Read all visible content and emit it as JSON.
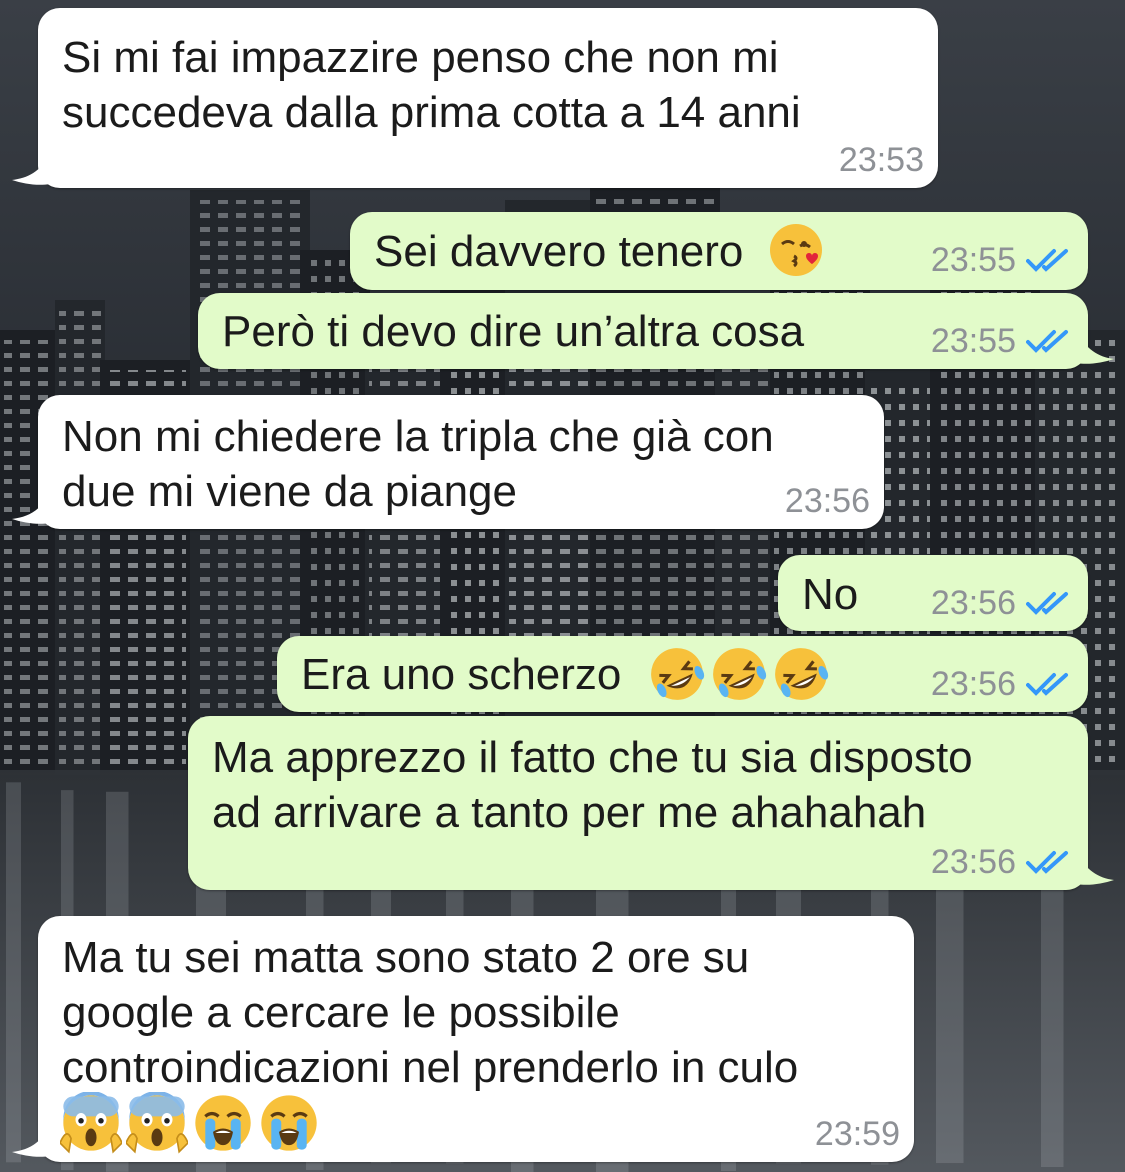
{
  "chat": {
    "messages": [
      {
        "direction": "incoming",
        "lines": [
          "Si mi fai impazzire penso che non mi",
          "succedeva dalla prima cotta a 14 anni"
        ],
        "time": "23:53"
      },
      {
        "direction": "outgoing",
        "text": "Sei davvero tenero",
        "emojis": [
          "face-blowing-a-kiss"
        ],
        "time": "23:55",
        "status": "read"
      },
      {
        "direction": "outgoing",
        "text": "Però ti devo dire un’altra cosa",
        "time": "23:55",
        "status": "read"
      },
      {
        "direction": "incoming",
        "lines": [
          "Non mi chiedere la tripla che già con",
          "due mi viene da piange"
        ],
        "time": "23:56"
      },
      {
        "direction": "outgoing",
        "text": "No",
        "time": "23:56",
        "status": "read"
      },
      {
        "direction": "outgoing",
        "text": "Era uno scherzo",
        "emojis": [
          "rolling-on-floor-laughing",
          "rolling-on-floor-laughing",
          "rolling-on-floor-laughing"
        ],
        "time": "23:56",
        "status": "read"
      },
      {
        "direction": "outgoing",
        "lines": [
          "Ma apprezzo il fatto che tu sia disposto",
          "ad arrivare a tanto per me ahahahah"
        ],
        "time": "23:56",
        "status": "read"
      },
      {
        "direction": "incoming",
        "lines": [
          "Ma tu sei matta sono stato 2 ore su",
          "google a cercare le possibile",
          "controindicazioni nel prenderlo in culo"
        ],
        "emojis": [
          "face-screaming-in-fear",
          "face-screaming-in-fear",
          "loudly-crying-face",
          "loudly-crying-face"
        ],
        "time": "23:59"
      }
    ]
  },
  "colors": {
    "incoming_bubble": "#ffffff",
    "outgoing_bubble": "#e2fbc9",
    "timestamp": "#8e9196",
    "read_ticks": "#3497f9"
  }
}
